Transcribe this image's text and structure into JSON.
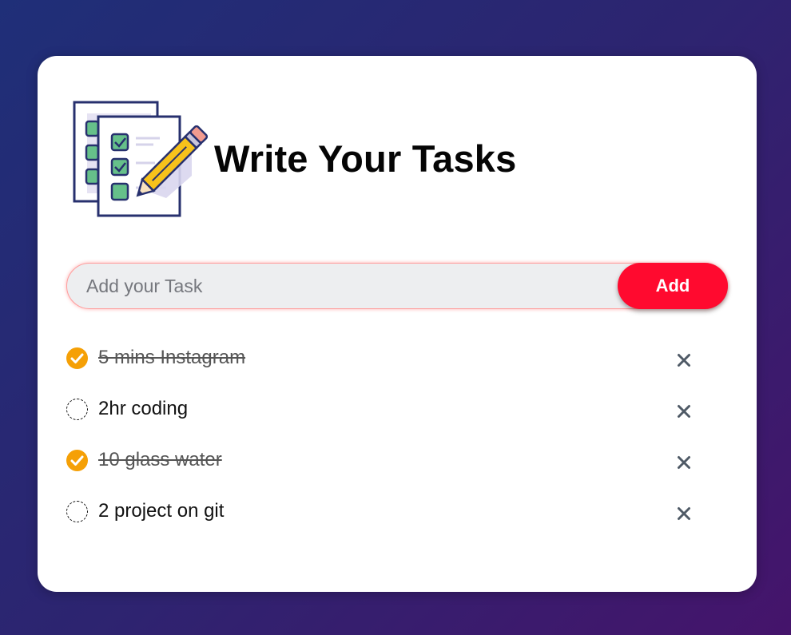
{
  "header": {
    "title": "Write Your Tasks",
    "logo_icon": "task-checklist-pencil-icon"
  },
  "input": {
    "placeholder": "Add your Task",
    "value": "",
    "add_label": "Add"
  },
  "colors": {
    "background_start": "#1f2f78",
    "background_end": "#45146b",
    "accent": "#ff0a2f",
    "checked": "#f5a006",
    "delete": "#4f5a66"
  },
  "tasks": [
    {
      "text": "5 mins Instagram",
      "done": true
    },
    {
      "text": "2hr coding",
      "done": false
    },
    {
      "text": "10 glass water",
      "done": true
    },
    {
      "text": "2 project on git",
      "done": false
    }
  ],
  "icons": {
    "checked": "checkmark-circle-icon",
    "unchecked": "empty-circle-icon",
    "delete": "close-icon"
  }
}
